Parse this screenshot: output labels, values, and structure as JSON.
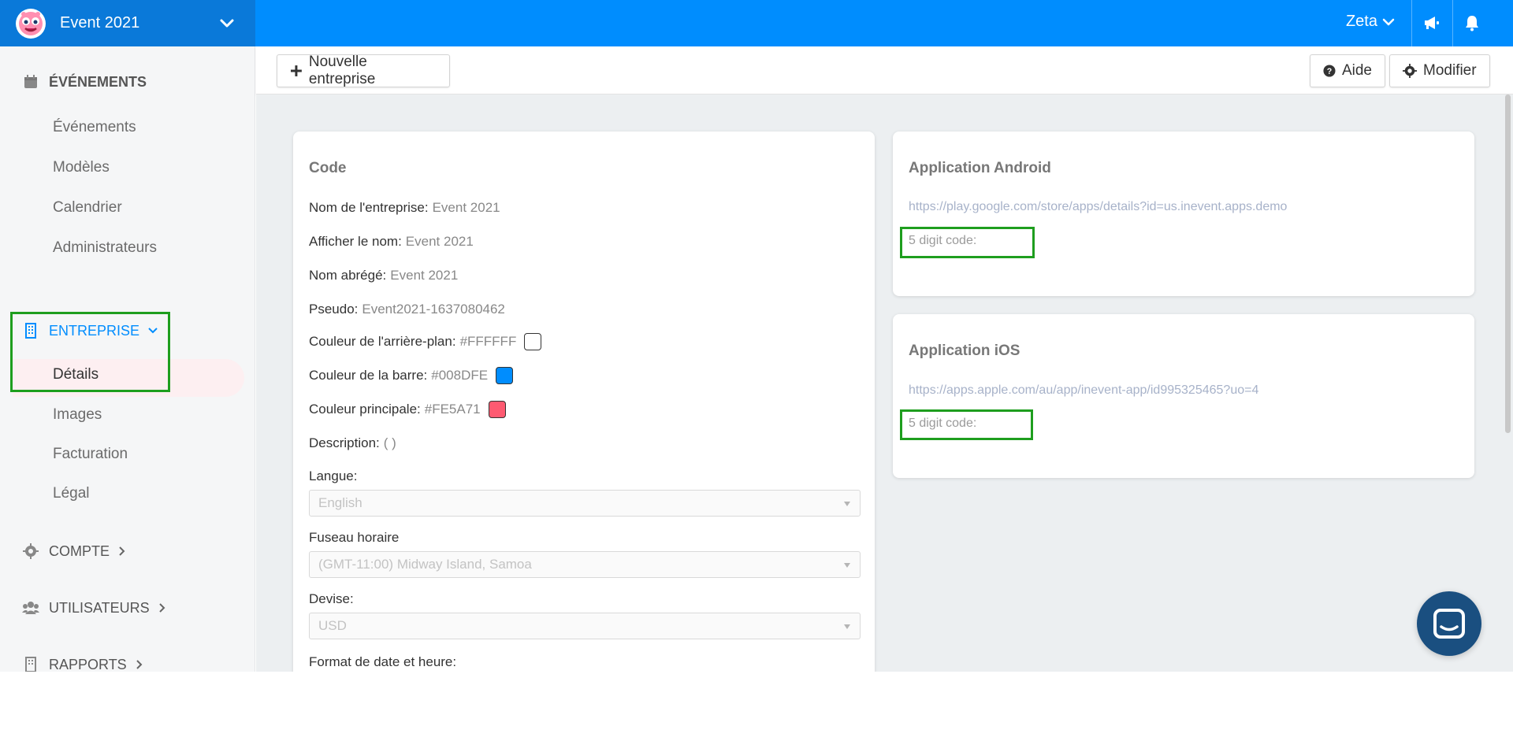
{
  "header": {
    "event_title": "Event 2021",
    "user_name": "Zeta",
    "icons": [
      "event-logo-icon",
      "chevron-down-icon",
      "megaphone-icon",
      "bell-icon"
    ],
    "bar_color": "#008DFE"
  },
  "sidebar": {
    "events_section": "ÉVÉNEMENTS",
    "events_items": [
      "Événements",
      "Modèles",
      "Calendrier",
      "Administrateurs"
    ],
    "company_section": "ENTREPRISE",
    "company_items": [
      "Détails",
      "Images",
      "Facturation",
      "Légal"
    ],
    "account_section": "COMPTE",
    "users_section": "UTILISATEURS",
    "reports_section": "RAPPORTS",
    "active_item": "Détails",
    "accent_color": "#008DFE"
  },
  "toolbar": {
    "new_company_label": "Nouvelle entreprise",
    "help_label": "Aide",
    "edit_label": "Modifier"
  },
  "code_card": {
    "title": "Code",
    "company_name_label": "Nom de l'entreprise:",
    "company_name_value": "Event 2021",
    "display_name_label": "Afficher le nom:",
    "display_name_value": "Event 2021",
    "short_name_label": "Nom abrégé:",
    "short_name_value": "Event 2021",
    "nickname_label": "Pseudo:",
    "nickname_value": "Event2021-1637080462",
    "bg_color_label": "Couleur de l'arrière-plan:",
    "bg_color_value": "#FFFFFF",
    "bar_color_label": "Couleur de la barre:",
    "bar_color_value": "#008DFE",
    "main_color_label": "Couleur principale:",
    "main_color_value": "#FE5A71",
    "description_label": "Description:",
    "description_value": "( )",
    "language_label": "Langue:",
    "language_value": "English",
    "timezone_label": "Fuseau horaire",
    "timezone_value": "(GMT-11:00) Midway Island, Samoa",
    "currency_label": "Devise:",
    "currency_value": "USD",
    "datetime_label": "Format de date et heure:"
  },
  "android_card": {
    "title": "Application Android",
    "url": "https://play.google.com/store/apps/details?id=us.inevent.apps.demo",
    "code_label": "5 digit code:"
  },
  "ios_card": {
    "title": "Application iOS",
    "url": "https://apps.apple.com/au/app/inevent-app/id995325465?uo=4",
    "code_label": "5 digit code:"
  },
  "highlight_color": "#1E9E1E"
}
